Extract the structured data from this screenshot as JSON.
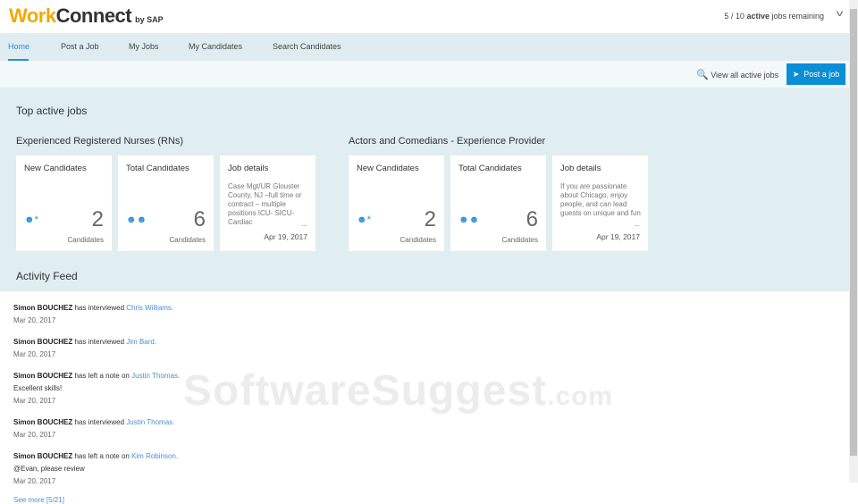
{
  "header": {
    "logo_work": "Work",
    "logo_connect": "Connect",
    "logo_by": "by SAP",
    "remaining_pre": "5 / 10 ",
    "remaining_bold": "active",
    "remaining_post": " jobs remaining"
  },
  "nav": [
    "Home",
    "Post a Job",
    "My Jobs",
    "My Candidates",
    "Search Candidates"
  ],
  "toolbar": {
    "view_all": "View all active jobs",
    "post_job": "Post a job"
  },
  "main": {
    "title": "Top active jobs",
    "jobs": [
      {
        "name": "Experienced Registered Nurses (RNs)",
        "new_label": "New Candidates",
        "new_count": "2",
        "total_label": "Total Candidates",
        "total_count": "6",
        "unit": "Candidates",
        "details_label": "Job details",
        "details": "Case Mgt/UR Glouster County, NJ –full time or contract – multiple positions ICU- SICU-Cardiac",
        "date": "Apr 19, 2017"
      },
      {
        "name": "Actors and Comedians - Experience Provider",
        "new_label": "New Candidates",
        "new_count": "2",
        "total_label": "Total Candidates",
        "total_count": "6",
        "unit": "Candidates",
        "details_label": "Job details",
        "details": "If you are passionate about Chicago, enjoy people, and can lead guests on unique and fun",
        "date": "Apr 19, 2017"
      }
    ]
  },
  "feed": {
    "title": "Activity Feed",
    "items": [
      {
        "user": "Simon BOUCHEZ",
        "action": " has interviewed ",
        "target": "Chris Williams.",
        "note": "",
        "date": "Mar 20, 2017"
      },
      {
        "user": "Simon BOUCHEZ",
        "action": " has interviewed ",
        "target": "Jim Bard.",
        "note": "",
        "date": "Mar 20, 2017"
      },
      {
        "user": "Simon BOUCHEZ",
        "action": " has left a note on ",
        "target": "Justin Thomas.",
        "note": "Excellent skills!",
        "date": "Mar 20, 2017"
      },
      {
        "user": "Simon BOUCHEZ",
        "action": " has interviewed ",
        "target": "Justin Thomas.",
        "note": "",
        "date": "Mar 20, 2017"
      },
      {
        "user": "Simon BOUCHEZ",
        "action": " has left a note on ",
        "target": "Kim Robinson.",
        "note": "@Evan, please review",
        "date": "Mar 20, 2017"
      }
    ],
    "see_more": "See more [5/21]"
  },
  "watermark": {
    "main": "SoftwareSuggest",
    "suffix": ".com"
  }
}
